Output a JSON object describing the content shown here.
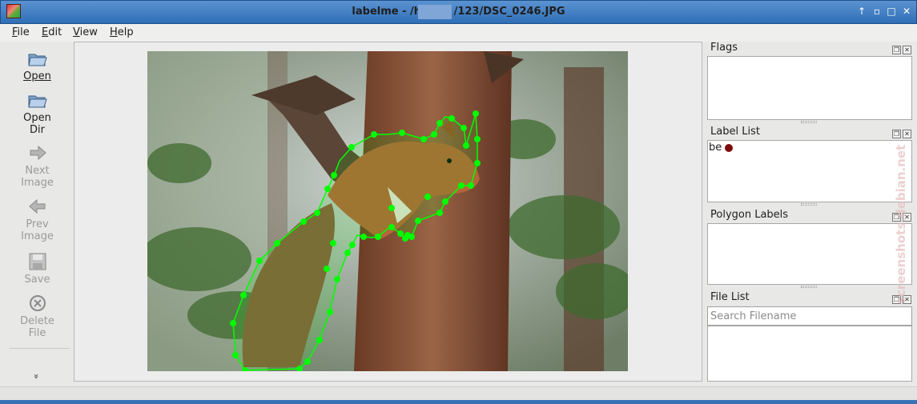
{
  "window": {
    "title": "labelme - /home/       /123/DSC_0246.JPG",
    "controls": [
      "↑",
      "▫",
      "□",
      "✕"
    ]
  },
  "menu": [
    "File",
    "Edit",
    "View",
    "Help"
  ],
  "toolbar": {
    "open": "Open",
    "open_dir": "Open\nDir",
    "next_image": "Next\nImage",
    "prev_image": "Prev\nImage",
    "save": "Save",
    "delete_file": "Delete\nFile",
    "extension": "»"
  },
  "docks": {
    "flags": {
      "title": "Flags"
    },
    "label_list": {
      "title": "Label List",
      "items": [
        {
          "text": "be",
          "color": "#7d0b0b"
        }
      ]
    },
    "polygon_labels": {
      "title": "Polygon Labels"
    },
    "file_list": {
      "title": "File List",
      "search_placeholder": "Search Filename"
    }
  },
  "watermark": "screenshots.debian.net",
  "colors": {
    "polygon": "#00ff00",
    "titlebar": "#3b7cc4"
  }
}
